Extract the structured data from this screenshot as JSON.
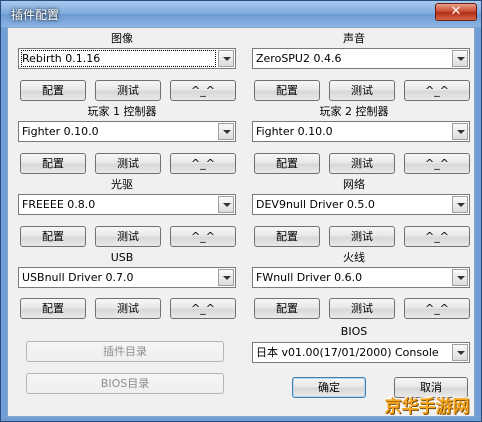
{
  "window": {
    "title": "插件配置",
    "close_label": "✕"
  },
  "plugins": {
    "graphics": {
      "label": "图像",
      "value": "Rebirth 0.1.16"
    },
    "sound": {
      "label": "声音",
      "value": "ZeroSPU2  0.4.6"
    },
    "pad1": {
      "label": "玩家 1 控制器",
      "value": "Fighter 0.10.0"
    },
    "pad2": {
      "label": "玩家 2 控制器",
      "value": "Fighter 0.10.0"
    },
    "cdrom": {
      "label": "光驱",
      "value": "FREEEE 0.8.0"
    },
    "network": {
      "label": "网络",
      "value": "DEV9null Driver 0.5.0"
    },
    "usb": {
      "label": "USB",
      "value": "USBnull Driver 0.7.0"
    },
    "firewire": {
      "label": "火线",
      "value": "FWnull Driver 0.6.0"
    },
    "bios": {
      "label": "BIOS",
      "value": "日本   v01.00(17/01/2000) Console"
    }
  },
  "buttons": {
    "configure": "配置",
    "test": "测试",
    "about": "^_^",
    "plugins_dir": "插件目录",
    "bios_dir": "BIOS目录",
    "ok": "确定",
    "cancel": "取消"
  },
  "watermark": "京华手游网"
}
